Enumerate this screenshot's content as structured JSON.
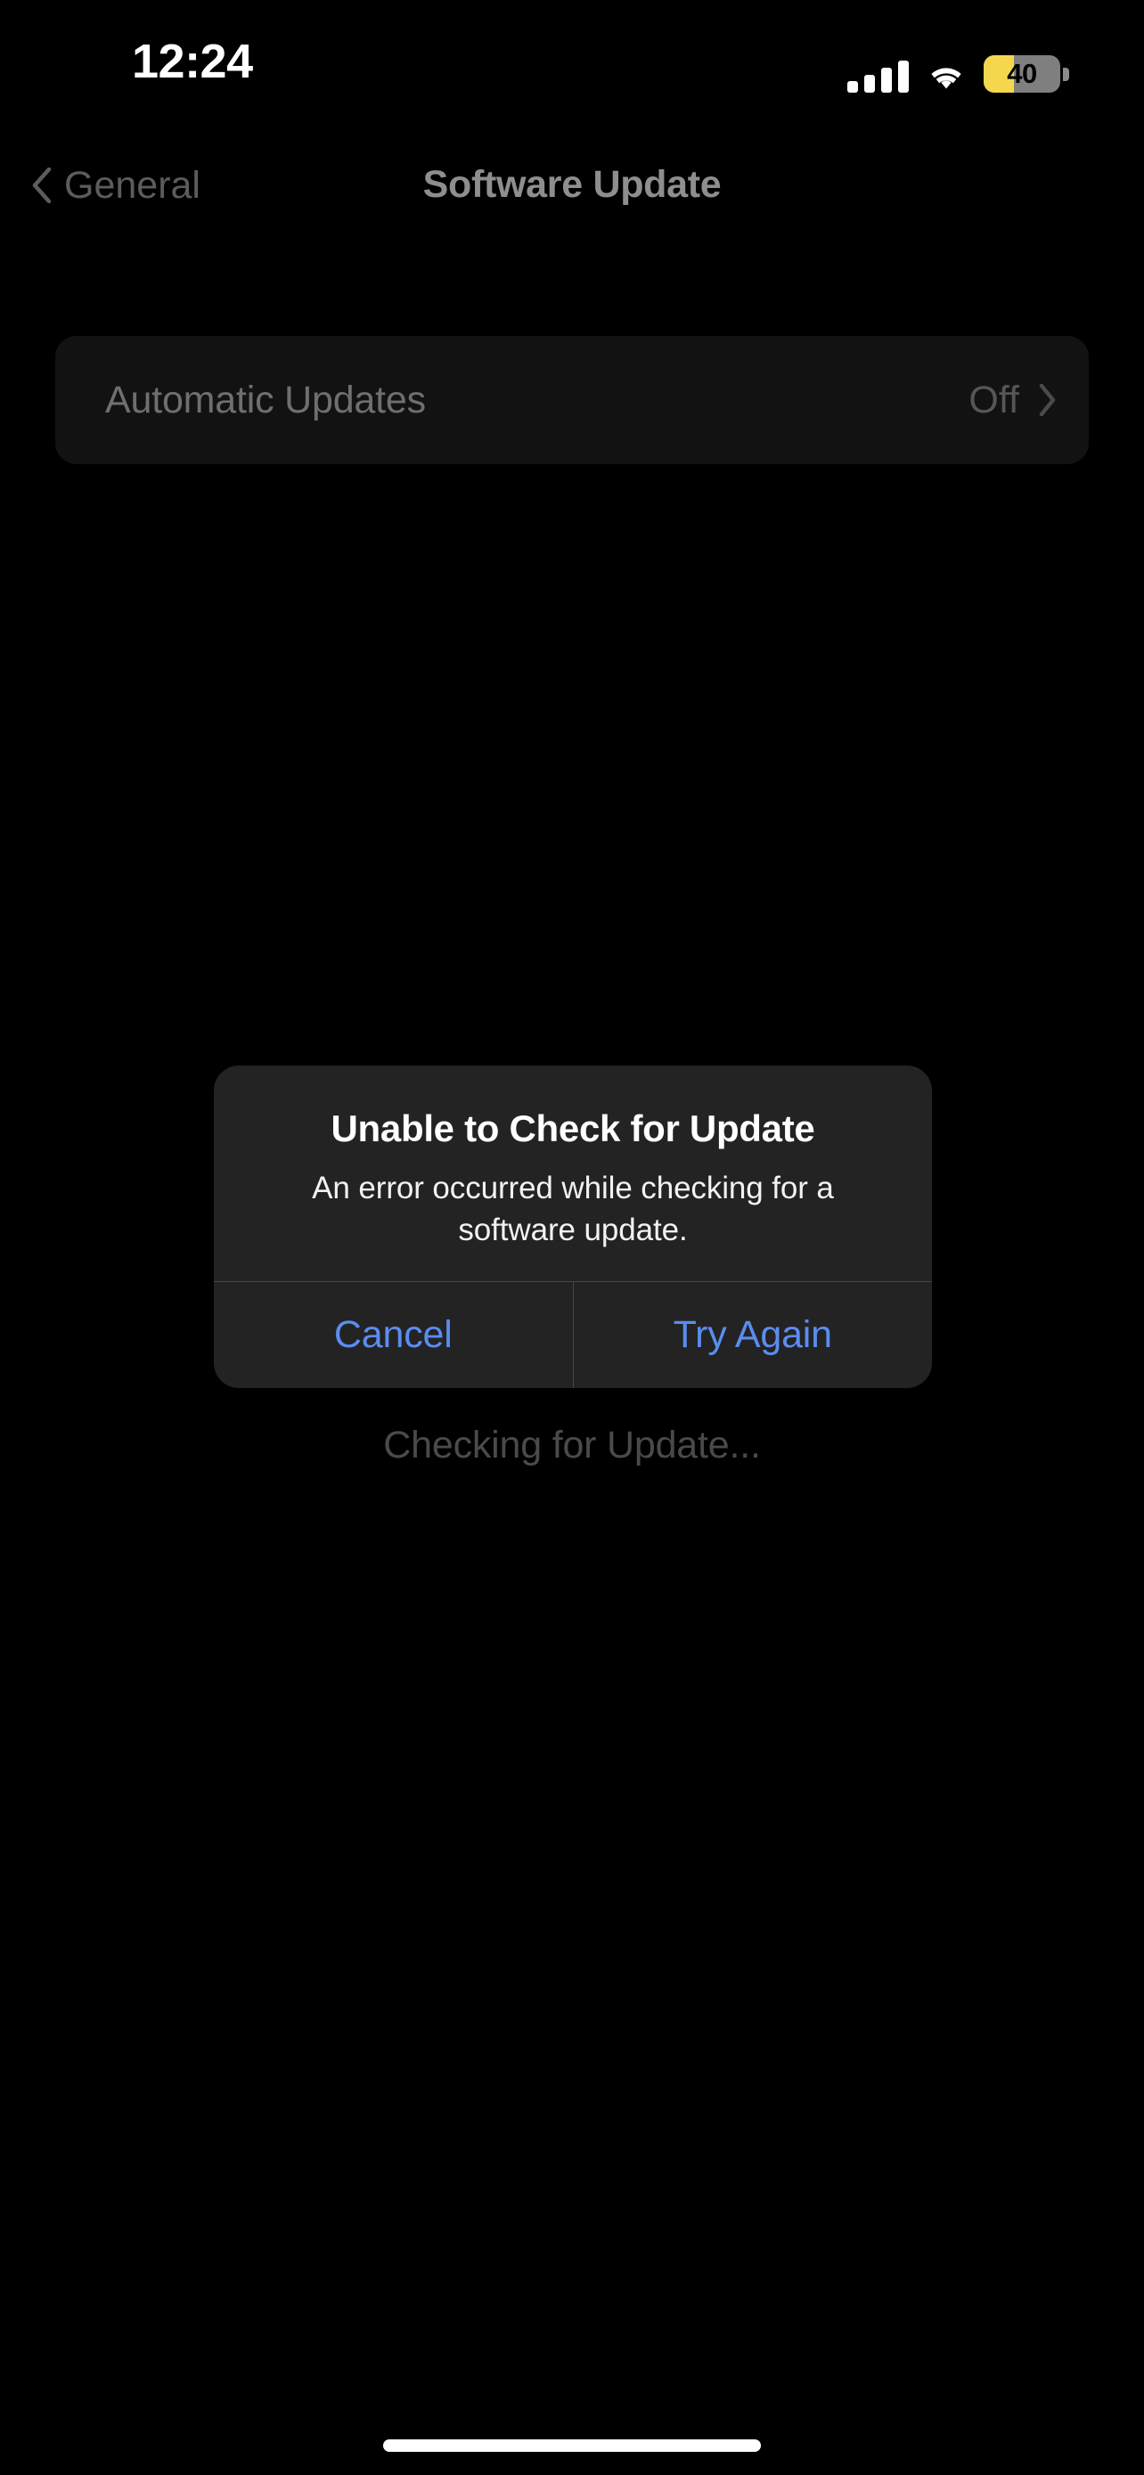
{
  "status_bar": {
    "time": "12:24",
    "cellular": {
      "icon": "cellular-bars-icon",
      "bars_total": 4,
      "bars_filled": 4
    },
    "wifi": {
      "icon": "wifi-icon",
      "strength": 3
    },
    "battery": {
      "icon": "battery-icon",
      "percent_label": "40",
      "percent": 40,
      "fill_color": "#f5d74e",
      "track_color": "#7f7f7f",
      "text_color": "#000000",
      "low_power_mode": true
    }
  },
  "nav_bar": {
    "back_label": "General",
    "back_icon": "chevron-left-icon",
    "title": "Software Update"
  },
  "settings": {
    "rows": [
      {
        "label": "Automatic Updates",
        "value": "Off",
        "accessory_icon": "chevron-right-icon"
      }
    ]
  },
  "page_status": {
    "checking_text": "Checking for Update..."
  },
  "alert": {
    "title": "Unable to Check for Update",
    "message": "An error occurred while checking for a software update.",
    "buttons": [
      {
        "label": "Cancel",
        "role": "cancel"
      },
      {
        "label": "Try Again",
        "role": "default"
      }
    ]
  },
  "home_indicator": {
    "visible": true
  },
  "colors": {
    "background": "#000000",
    "card": "#121212",
    "alert_background": "#232323",
    "alert_divider": "#474747",
    "accent_blue": "#5b8df0",
    "dimmed_label": "#6f6f6f",
    "dimmed_value": "#565656",
    "nav_title": "#8e8e8e",
    "nav_back": "#5c5c5c",
    "status_text": "#4a4a4a",
    "battery_yellow": "#f5d74e"
  }
}
